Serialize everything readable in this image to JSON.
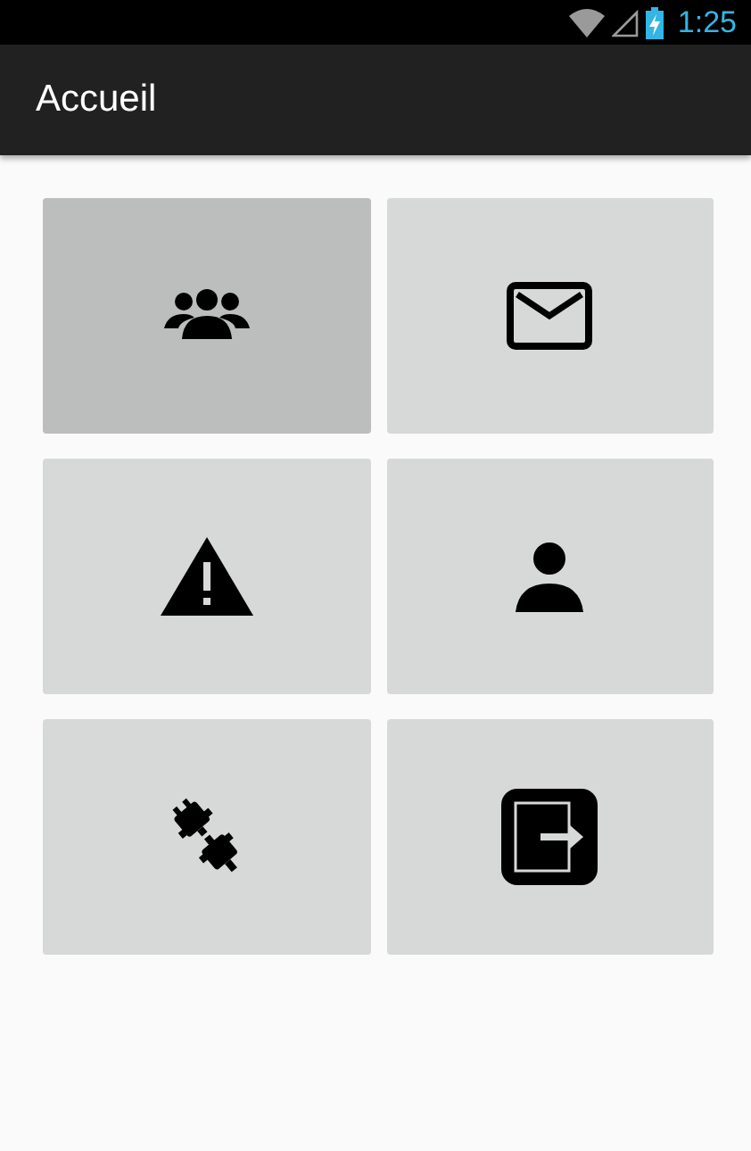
{
  "status_bar": {
    "time": "1:25"
  },
  "action_bar": {
    "title": "Accueil"
  },
  "tiles": [
    {
      "kind": "group",
      "selected": true
    },
    {
      "kind": "mail",
      "selected": false
    },
    {
      "kind": "warning",
      "selected": false
    },
    {
      "kind": "person",
      "selected": false
    },
    {
      "kind": "plug",
      "selected": false
    },
    {
      "kind": "exit",
      "selected": false
    }
  ]
}
